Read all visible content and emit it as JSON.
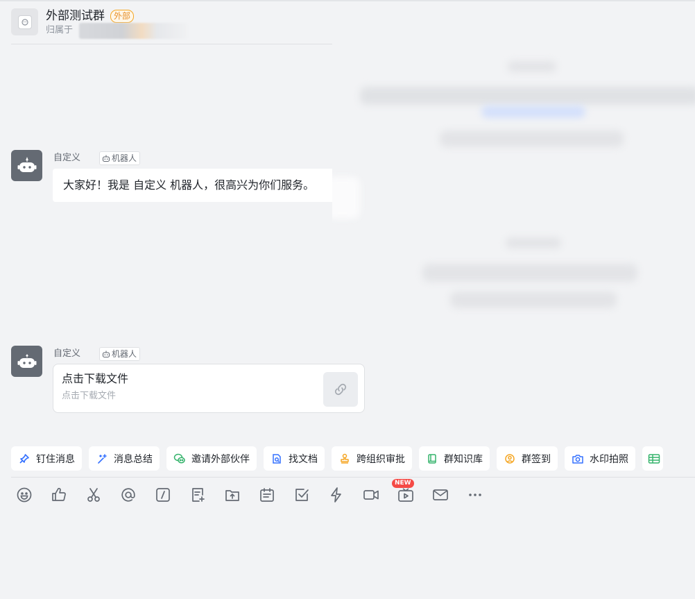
{
  "header": {
    "group_name": "外部测试群",
    "external_badge": "外部",
    "belongs_label": "归属于"
  },
  "messages": [
    {
      "sender": "自定义",
      "bot_tag": "机器人",
      "text": "大家好！我是 自定义 机器人，很高兴为你们服务。"
    },
    {
      "sender": "自定义",
      "bot_tag": "机器人",
      "card_title": "点击下载文件",
      "card_subtitle": "点击下载文件"
    }
  ],
  "shortcuts": [
    {
      "label": "钉住消息",
      "icon": "pin-icon"
    },
    {
      "label": "消息总结",
      "icon": "magic-wand-icon"
    },
    {
      "label": "邀请外部伙伴",
      "icon": "wechat-icon"
    },
    {
      "label": "找文档",
      "icon": "doc-search-icon"
    },
    {
      "label": "跨组织审批",
      "icon": "stamp-icon"
    },
    {
      "label": "群知识库",
      "icon": "book-icon"
    },
    {
      "label": "群签到",
      "icon": "checkin-icon"
    },
    {
      "label": "水印拍照",
      "icon": "camera-icon"
    }
  ],
  "toolbar": {
    "new_badge": "NEW",
    "icons": [
      "emoji-icon",
      "thumbs-up-icon",
      "scissors-icon",
      "at-icon",
      "slash-command-icon",
      "note-add-icon",
      "upload-icon",
      "calendar-icon",
      "task-check-icon",
      "lightning-icon",
      "video-icon",
      "live-icon",
      "mail-icon",
      "more-icon"
    ]
  },
  "colors": {
    "background": "#f2f3f5",
    "avatar_gray": "#646a73",
    "badge_orange": "#e6912c",
    "new_red": "#f54a45",
    "icon_blue": "#3370ff",
    "icon_green": "#34b36b",
    "icon_orange": "#f5a623"
  }
}
